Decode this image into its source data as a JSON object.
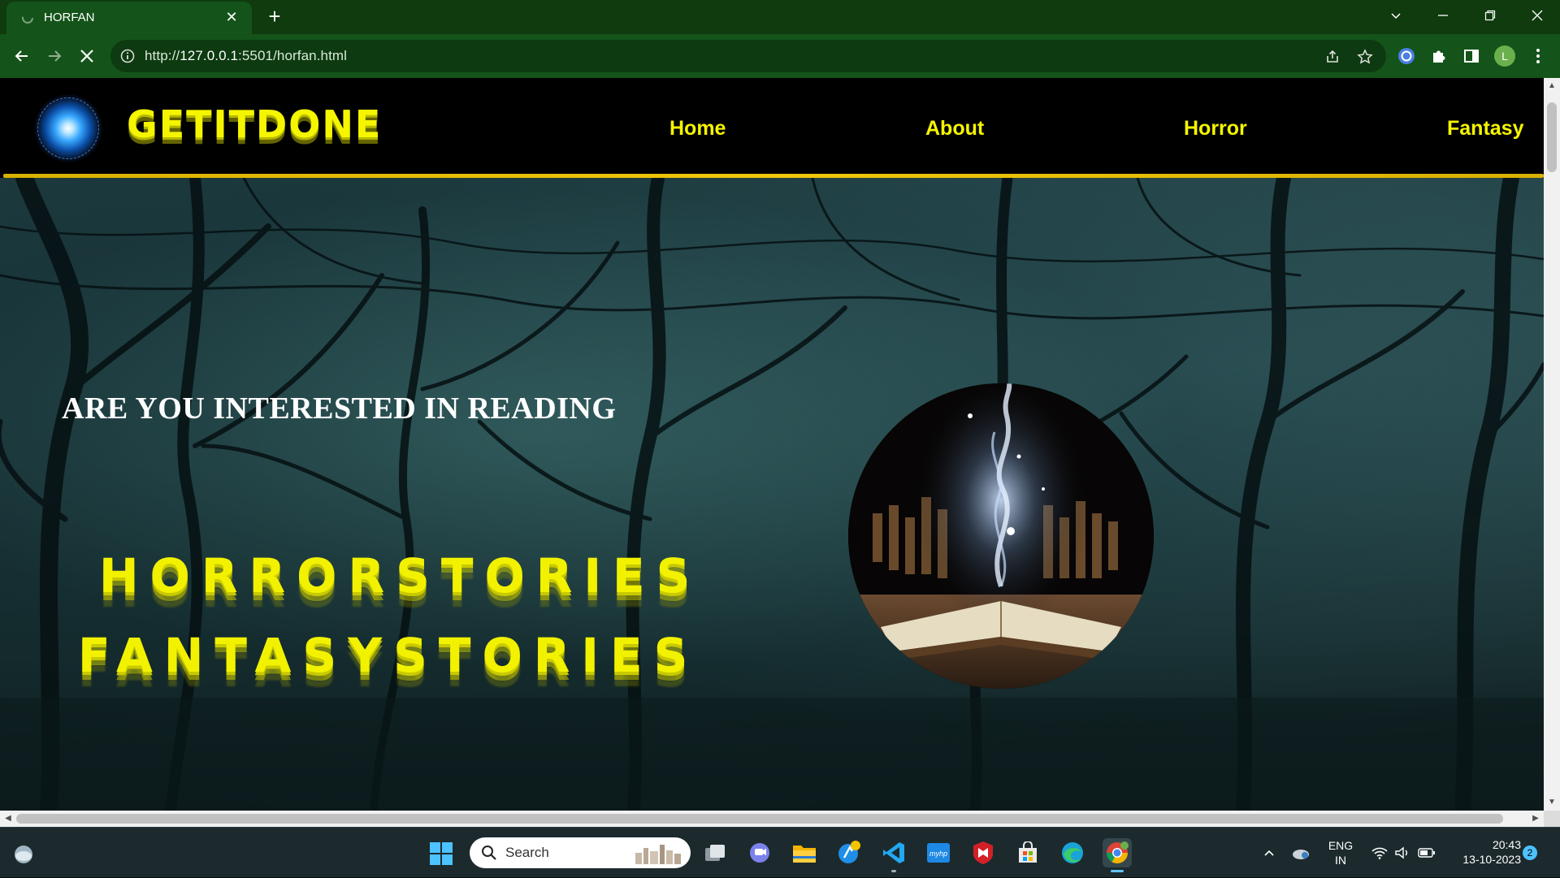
{
  "browser": {
    "tab_title": "HORFAN",
    "tab_close": "✕",
    "new_tab": "+",
    "url_prefix": "http://",
    "url_host": "127.0.0.1",
    "url_rest": ":5501/horfan.html",
    "profile_initial": "L",
    "accent_color": "#14541a",
    "tabstrip_color": "#0f3b0f"
  },
  "site": {
    "brand": "GETITDONE",
    "nav": [
      "Home",
      "About",
      "Horror",
      "Fantasy"
    ],
    "accent_color": "#f5f500",
    "hero": {
      "question": "ARE YOU INTERESTED IN READING",
      "line1": "HORRORSTORIES",
      "line2": "FANTASYSTORIES"
    }
  },
  "taskbar": {
    "search_label": "Search",
    "language_top": "ENG",
    "language_bottom": "IN",
    "time": "20:43",
    "date": "13-10-2023",
    "notification_count": "2",
    "apps": [
      "weather-icon",
      "windows-start-icon",
      "task-view-icon",
      "teams-chat-icon",
      "file-explorer-icon",
      "intel-app-icon",
      "vscode-icon",
      "myhp-icon",
      "mcafee-icon",
      "microsoft-store-icon",
      "edge-icon",
      "chrome-icon"
    ]
  }
}
